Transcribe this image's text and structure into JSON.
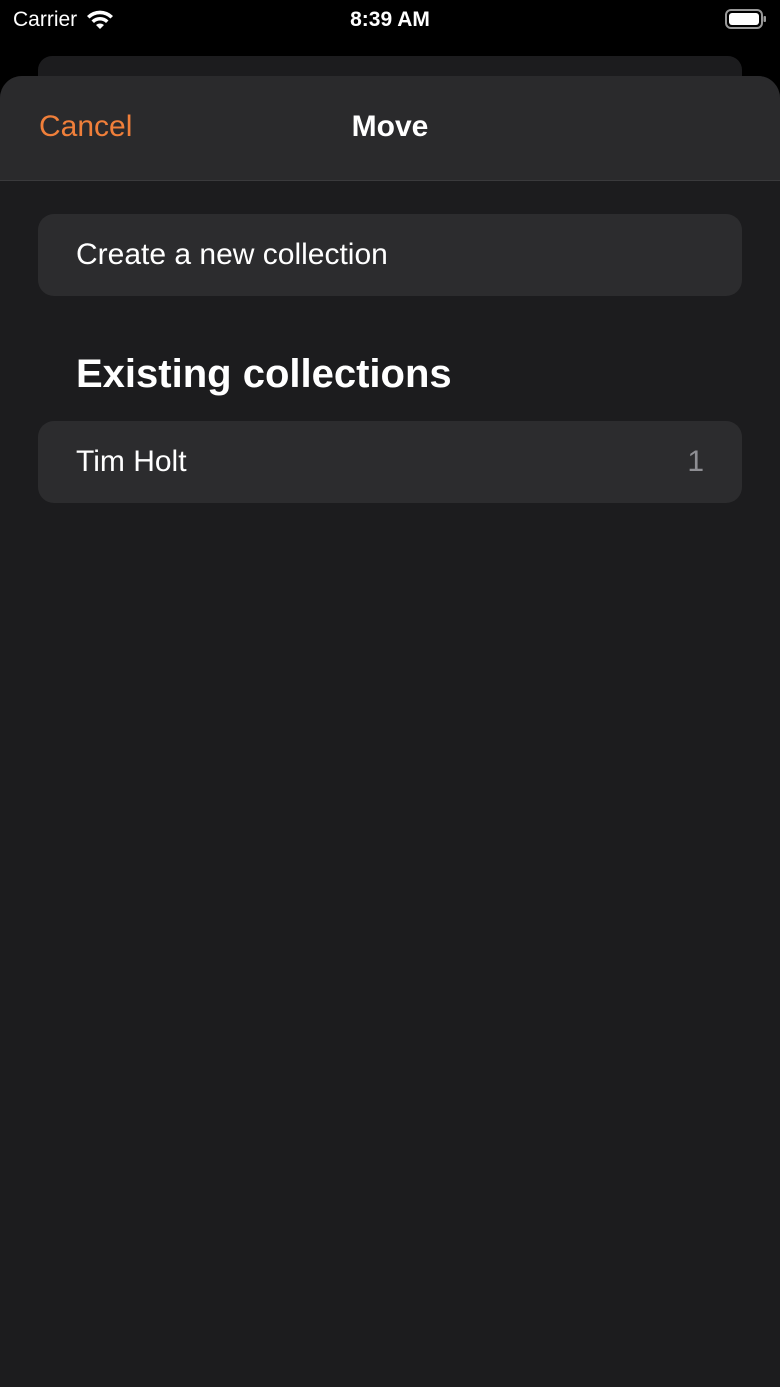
{
  "status_bar": {
    "carrier": "Carrier",
    "time": "8:39 AM",
    "icons": [
      "wifi-icon",
      "battery-icon"
    ]
  },
  "nav": {
    "cancel_label": "Cancel",
    "title": "Move"
  },
  "create_new": {
    "label": "Create a new collection"
  },
  "existing": {
    "heading": "Existing collections",
    "items": [
      {
        "label": "Tim Holt",
        "count": "1"
      }
    ]
  },
  "colors": {
    "accent": "#f07f3a",
    "background": "#1c1c1e",
    "card": "#2c2c2e",
    "nav_bar": "#2a2a2c"
  }
}
